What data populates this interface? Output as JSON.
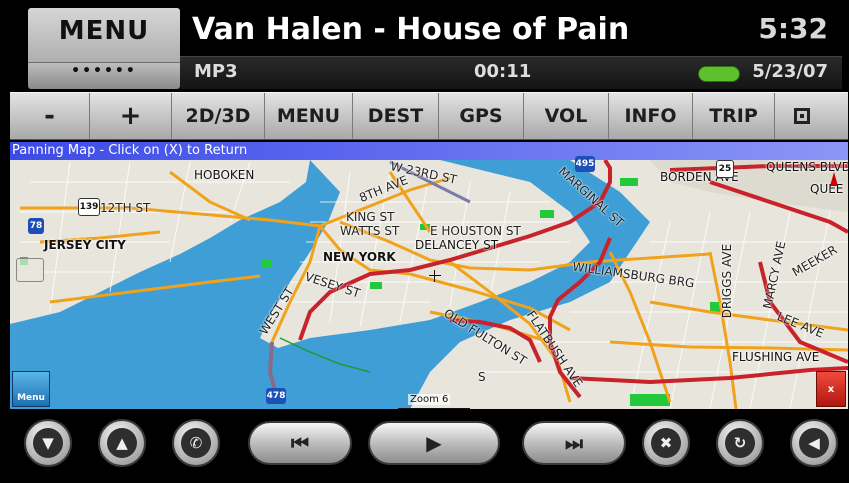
{
  "header": {
    "menu_label": "MENU",
    "menu_dots": "••••••",
    "song_title": "Van Halen - House of Pain",
    "clock": "5:32",
    "format": "MP3",
    "elapsed": "00:11",
    "date": "5/23/07",
    "status_color": "#5cc12c"
  },
  "toolbar": {
    "buttons": [
      {
        "label": "-"
      },
      {
        "label": "+"
      },
      {
        "label": "2D/3D"
      },
      {
        "label": "MENU"
      },
      {
        "label": "DEST"
      },
      {
        "label": "GPS"
      },
      {
        "label": "VOL"
      },
      {
        "label": "INFO"
      },
      {
        "label": "TRIP"
      },
      {
        "icon": "window-icon"
      }
    ]
  },
  "map": {
    "banner": "Panning Map - Click on (X) to Return",
    "labels": {
      "hoboken": "HOBOKEN",
      "jersey_city": "JERSEY CITY",
      "new_york": "NEW YORK",
      "twelfth_st": "12TH ST",
      "w23rd_st": "W 23RD ST",
      "eighth_ave": "8TH AVE",
      "king_st": "KING ST",
      "watts_st": "WATTS ST",
      "e_houston_st": "E HOUSTON ST",
      "delancey_st": "DELANCEY ST",
      "vesey_st": "VESEY ST",
      "west_st": "WEST ST",
      "marginal_st": "MARGINAL ST",
      "williamsburg_brg": "WILLIAMSBURG BRG",
      "borden_ave": "BORDEN AVE",
      "queens_blvd": "QUEENS BLVD",
      "queens": "QUEE",
      "driggs_ave": "DRIGGS AVE",
      "marcy_ave": "MARCY AVE",
      "meeker": "MEEKER",
      "lee_ave": "LEE AVE",
      "flushing_ave": "FLUSHING AVE",
      "old_fulton_st": "OLD FULTON ST",
      "flatbush_ave": "FLATBUSH AVE",
      "s": "S"
    },
    "shields": {
      "s139": "139",
      "s78": "78",
      "s495": "495",
      "s25": "25",
      "s478": "478"
    },
    "menu_button": "Menu",
    "close_button": "x",
    "zoom": "Zoom 6",
    "colors": {
      "water": "#3f9ed6",
      "land": "#e8e6dc",
      "primary_road": "#c8222a",
      "secondary_road": "#f0a21c",
      "park": "#22c93a"
    }
  },
  "controls": {
    "buttons": [
      {
        "icon": "chevron-down-icon"
      },
      {
        "icon": "chevron-up-icon"
      },
      {
        "icon": "phone-icon"
      },
      {
        "icon": "previous-track-icon"
      },
      {
        "icon": "play-icon"
      },
      {
        "icon": "next-track-icon"
      },
      {
        "icon": "shuffle-icon"
      },
      {
        "icon": "repeat-icon"
      },
      {
        "icon": "back-arrow-icon"
      }
    ]
  }
}
